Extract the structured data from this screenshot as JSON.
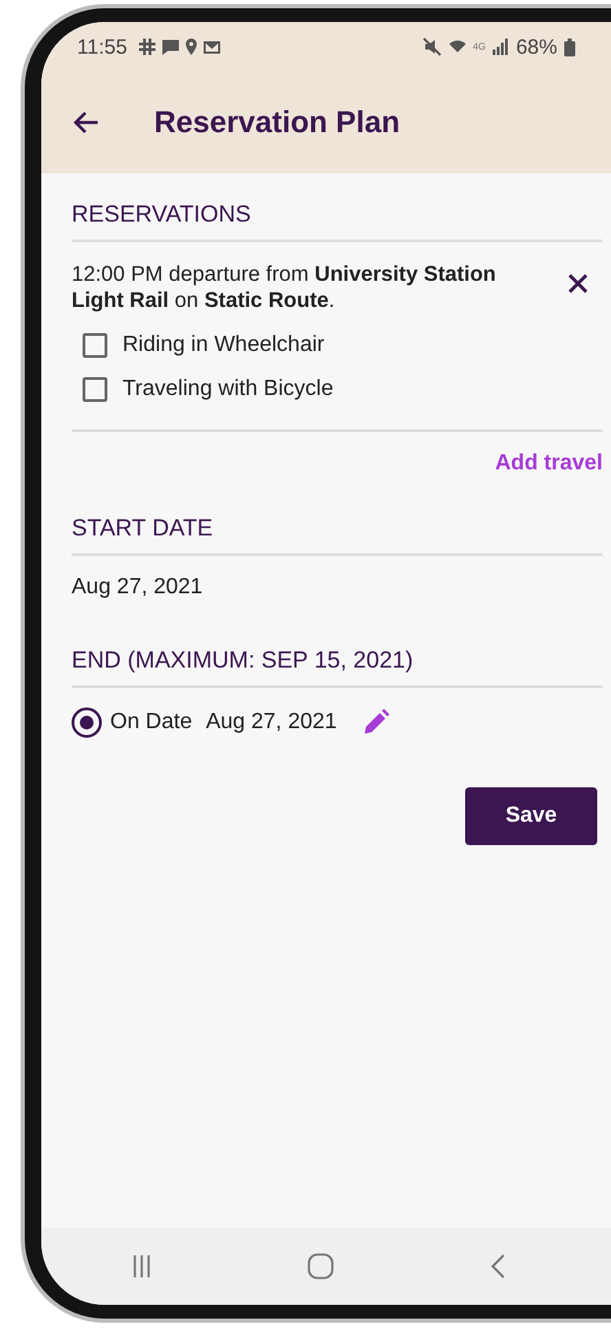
{
  "status_bar": {
    "time": "11:55",
    "network": "4G",
    "battery": "68%"
  },
  "app_bar": {
    "title": "Reservation Plan"
  },
  "reservations": {
    "heading": "RESERVATIONS",
    "items": [
      {
        "text": "12:00 PM departure from **University Station Light Rail** on **Static Route**.",
        "options": [
          {
            "label": "Riding in Wheelchair",
            "checked": false
          },
          {
            "label": "Traveling with Bicycle",
            "checked": false
          }
        ]
      }
    ],
    "add_link": "Add travel"
  },
  "start_date": {
    "heading": "START DATE",
    "value": "Aug 27, 2021"
  },
  "end": {
    "heading": "END (MAXIMUM: SEP 15, 2021)",
    "options": [
      {
        "label": "On Date",
        "value": "Aug 27, 2021",
        "selected": true
      }
    ]
  },
  "save_button": "Save"
}
